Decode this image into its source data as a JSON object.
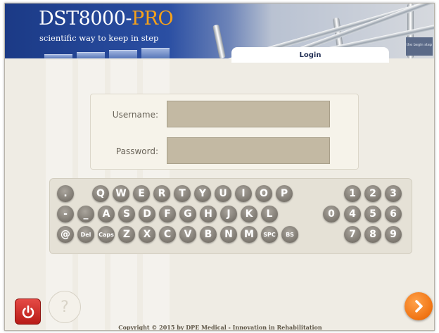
{
  "header": {
    "logo_main": "DST8000-",
    "logo_accent": "PRO",
    "tagline": "scientific way to keep in step",
    "corner_logo_text": "the begin step",
    "tab_label": "Login"
  },
  "form": {
    "username_label": "Username:",
    "username_value": "",
    "password_label": "Password:",
    "password_value": ""
  },
  "keyboard": {
    "rows": [
      [
        ".",
        "Q",
        "W",
        "E",
        "R",
        "T",
        "Y",
        "U",
        "I",
        "O",
        "P"
      ],
      [
        "-",
        "_",
        "A",
        "S",
        "D",
        "F",
        "G",
        "H",
        "J",
        "K",
        "L",
        "0"
      ],
      [
        "@",
        "Del",
        "Caps",
        "Z",
        "X",
        "C",
        "V",
        "B",
        "N",
        "M",
        "SPC",
        "BS"
      ]
    ],
    "numpad": [
      [
        "1",
        "2",
        "3"
      ],
      [
        "4",
        "5",
        "6"
      ],
      [
        "7",
        "8",
        "9"
      ]
    ]
  },
  "footer": {
    "help_label": "?",
    "copyright": "Copyright © 2015 by DPE Medical - Innovation in Rehabilitation"
  },
  "colors": {
    "brand_blue": "#1b3a86",
    "accent_orange": "#f07312",
    "power_red": "#d0302b",
    "key_gray": "#7c776f"
  },
  "icons": {
    "power": "power-icon",
    "next": "chevron-right-icon"
  }
}
